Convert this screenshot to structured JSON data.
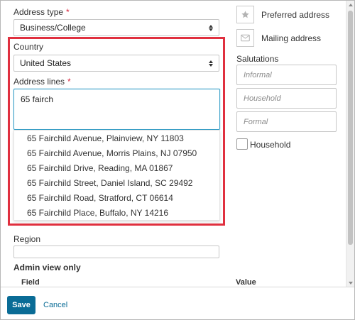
{
  "form": {
    "address_type": {
      "label": "Address type",
      "required_mark": "*",
      "value": "Business/College"
    },
    "country": {
      "label": "Country",
      "value": "United States"
    },
    "address_lines": {
      "label": "Address lines",
      "required_mark": "*",
      "value": "65 fairch",
      "suggestions": [
        "65 Fairchild Avenue, Plainview, NY 11803",
        "65 Fairchild Avenue, Morris Plains, NJ 07950",
        "65 Fairchild Drive, Reading, MA 01867",
        "65 Fairchild Street, Daniel Island, SC 29492",
        "65 Fairchild Road, Stratford, CT 06614",
        "65 Fairchild Place, Buffalo, NY 14216"
      ]
    },
    "region": {
      "label": "Region",
      "value": ""
    },
    "admin": {
      "heading": "Admin view only",
      "col_field": "Field",
      "col_value": "Value"
    }
  },
  "side": {
    "preferred_label": "Preferred address",
    "mailing_label": "Mailing address",
    "salutations_label": "Salutations",
    "informal_placeholder": "Informal",
    "household_placeholder": "Household",
    "formal_placeholder": "Formal",
    "household_checkbox_label": "Household"
  },
  "footer": {
    "save_label": "Save",
    "cancel_label": "Cancel"
  },
  "colors": {
    "accent": "#0a6c96",
    "highlight": "#e0303f",
    "focus": "#3aa0c9",
    "required": "#d7263d"
  },
  "icons": {
    "preferred": "star-icon",
    "mailing": "envelope-icon"
  }
}
